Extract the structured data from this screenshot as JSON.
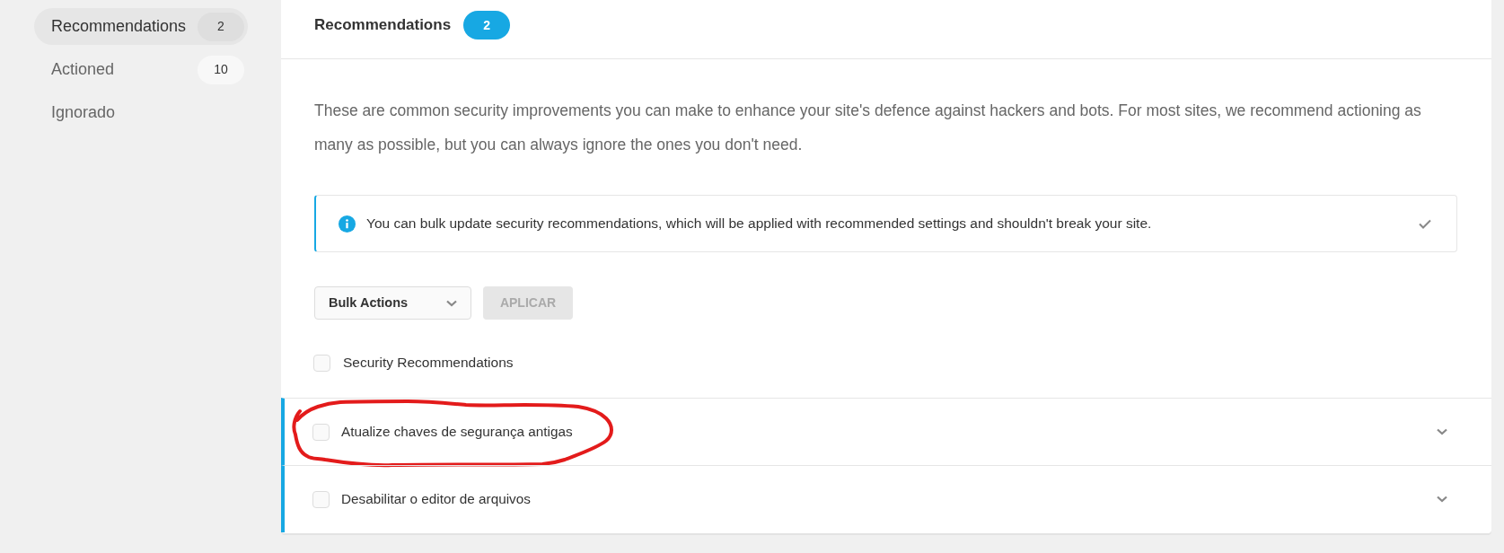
{
  "sidebar": {
    "items": [
      {
        "label": "Recommendations",
        "count": "2",
        "selected": true
      },
      {
        "label": "Actioned",
        "count": "10",
        "selected": false
      },
      {
        "label": "Ignorado",
        "selected": false
      }
    ]
  },
  "header": {
    "title": "Recommendations",
    "count": "2"
  },
  "description": "These are common security improvements you can make to enhance your site's defence against hackers and bots. For most sites, we recommend actioning as many as possible, but you can always ignore the ones you don't need.",
  "notice": {
    "text": "You can bulk update security recommendations, which will be applied with recommended settings and shouldn't break your site."
  },
  "bulk_actions": {
    "select": {
      "value": "Bulk Actions"
    },
    "apply_button": {
      "label": "APLICAR",
      "disabled": true
    }
  },
  "select_all": {
    "label": "Security Recommendations",
    "checked": false
  },
  "recommendations": [
    {
      "label": "Atualize chaves de segurança antigas",
      "checked": false,
      "circled": true
    },
    {
      "label": "Desabilitar o editor de arquivos",
      "checked": false,
      "circled": false
    }
  ]
}
